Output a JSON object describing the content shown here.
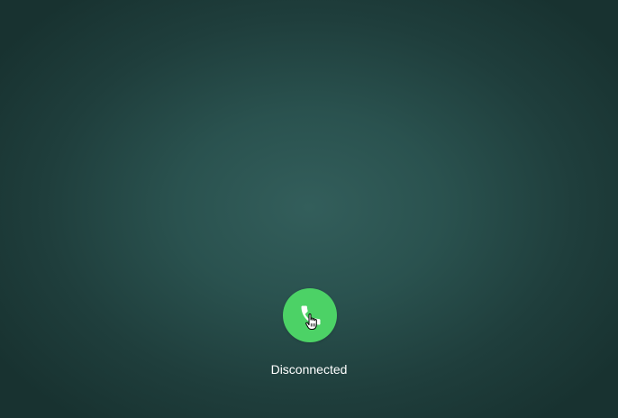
{
  "call": {
    "status": "Disconnected",
    "button_icon": "phone-icon",
    "button_color": "#4cd266",
    "background_color": "#2a524f"
  },
  "cursor": {
    "icon": "hand-pointer-icon"
  }
}
